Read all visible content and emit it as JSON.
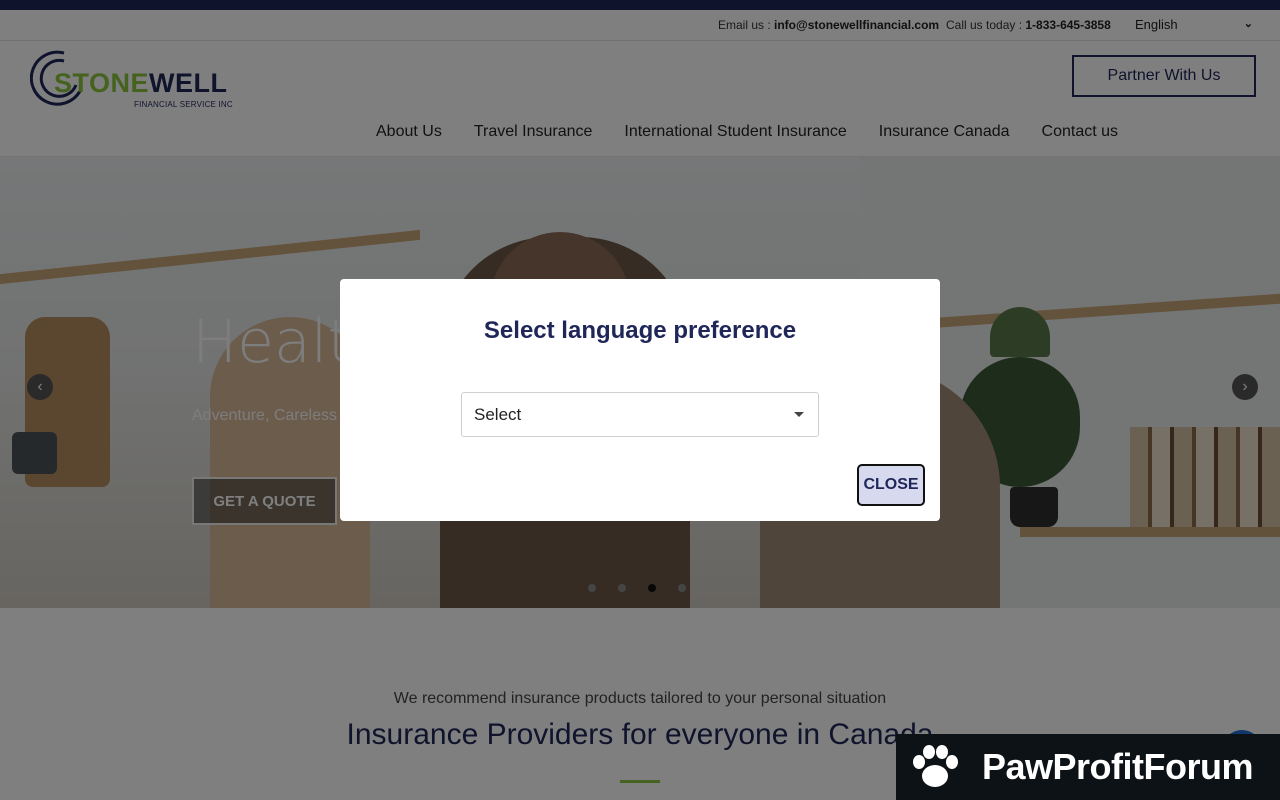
{
  "topbar": {
    "email_label": "Email us : ",
    "email": "info@stonewellfinancial.com",
    "phone_label": "Call us today : ",
    "phone": "1-833-645-3858",
    "language": "English"
  },
  "header": {
    "logo_part1": "STONE",
    "logo_part2": "WELL",
    "logo_sub": "FINANCIAL SERVICE INC",
    "partner_button": "Partner With Us",
    "nav": [
      "About Us",
      "Travel Insurance",
      "International Student Insurance",
      "Insurance Canada",
      "Contact us"
    ]
  },
  "hero": {
    "title": "Healt",
    "subtitle": "Adventure, Careless",
    "quote_button": "GET A QUOTE",
    "slides": 4,
    "active_slide": 3
  },
  "section": {
    "recommend": "We recommend insurance products tailored to your personal situation",
    "title": "Insurance Providers for everyone in Canada"
  },
  "modal": {
    "title": "Select language preference",
    "select_value": "Select",
    "close_button": "CLOSE"
  },
  "watermark": {
    "text": "PawProfitForum"
  },
  "colors": {
    "brand_navy": "#1f2658",
    "brand_green": "#8bc53f",
    "close_bg": "#d7d9ef"
  },
  "icons": {
    "carousel_prev": "chevron-left-icon",
    "carousel_next": "chevron-right-icon",
    "language_dropdown": "chevron-down-icon",
    "select_caret": "caret-down-icon",
    "watermark": "paw-icon"
  }
}
